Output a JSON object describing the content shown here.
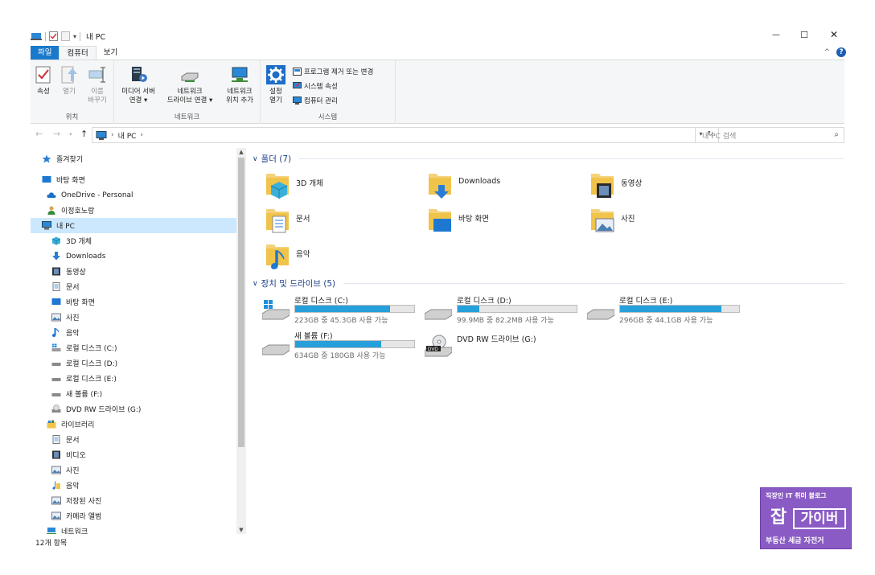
{
  "window": {
    "title": "내 PC",
    "minimize_glyph": "—",
    "maximize_glyph": "☐",
    "close_glyph": "✕"
  },
  "ribbon_tabs": [
    {
      "label": "파일"
    },
    {
      "label": "컴퓨터"
    },
    {
      "label": "보기"
    }
  ],
  "ribbon": {
    "location": {
      "label": "위치",
      "buttons": [
        {
          "label": "속성",
          "icon": "properties-icon"
        },
        {
          "label": "열기",
          "icon": "open-icon"
        },
        {
          "label": "이름\n바꾸기",
          "icon": "rename-icon"
        }
      ]
    },
    "network": {
      "label": "네트워크",
      "buttons": [
        {
          "label": "미디어 서버\n연결 ▾",
          "icon": "media-server-icon"
        },
        {
          "label": "네트워크\n드라이브 연결 ▾",
          "icon": "map-drive-icon"
        },
        {
          "label": "네트워크\n위치 추가",
          "icon": "network-location-icon"
        }
      ]
    },
    "system": {
      "label": "시스템",
      "settings": {
        "label": "설정\n열기",
        "icon": "gear-icon"
      },
      "small_buttons": [
        {
          "label": "프로그램 제거 또는 변경",
          "icon": "uninstall-icon"
        },
        {
          "label": "시스템 속성",
          "icon": "system-properties-icon"
        },
        {
          "label": "컴퓨터 관리",
          "icon": "computer-management-icon"
        }
      ]
    }
  },
  "address": {
    "path": [
      "내 PC"
    ],
    "separator": "›",
    "search_placeholder": "내 PC 검색"
  },
  "sidebar": {
    "items": [
      {
        "label": "즐겨찾기",
        "icon": "star-icon"
      },
      {
        "label": "바탕 화면",
        "icon": "desktop-icon"
      },
      {
        "label": "OneDrive - Personal",
        "icon": "cloud-icon"
      },
      {
        "label": "이정호노랑",
        "icon": "user-icon"
      },
      {
        "label": "내 PC",
        "icon": "pc-icon"
      },
      {
        "label": "3D 개체",
        "icon": "cube-icon"
      },
      {
        "label": "Downloads",
        "icon": "download-icon"
      },
      {
        "label": "동영상",
        "icon": "video-icon"
      },
      {
        "label": "문서",
        "icon": "document-icon"
      },
      {
        "label": "바탕 화면",
        "icon": "desktop-icon"
      },
      {
        "label": "사진",
        "icon": "picture-icon"
      },
      {
        "label": "음악",
        "icon": "music-icon"
      },
      {
        "label": "로컬 디스크 (C:)",
        "icon": "windows-drive-icon"
      },
      {
        "label": "로컬 디스크 (D:)",
        "icon": "drive-icon"
      },
      {
        "label": "로컬 디스크 (E:)",
        "icon": "drive-icon"
      },
      {
        "label": "새 볼륨 (F:)",
        "icon": "drive-icon"
      },
      {
        "label": "DVD RW 드라이브 (G:)",
        "icon": "dvd-icon"
      },
      {
        "label": "라이브러리",
        "icon": "library-icon"
      },
      {
        "label": "문서",
        "icon": "document-icon"
      },
      {
        "label": "비디오",
        "icon": "video-icon"
      },
      {
        "label": "사진",
        "icon": "picture-icon"
      },
      {
        "label": "음악",
        "icon": "music-icon"
      },
      {
        "label": "저장된 사진",
        "icon": "picture-icon"
      },
      {
        "label": "카메라 앨범",
        "icon": "picture-icon"
      },
      {
        "label": "네트워크",
        "icon": "network-icon"
      }
    ]
  },
  "folders_section": {
    "title": "폴더 (7)",
    "items": [
      {
        "label": "3D 개체",
        "icon": "cube-folder-icon"
      },
      {
        "label": "Downloads",
        "icon": "download-folder-icon"
      },
      {
        "label": "동영상",
        "icon": "video-folder-icon"
      },
      {
        "label": "문서",
        "icon": "document-folder-icon"
      },
      {
        "label": "바탕 화면",
        "icon": "desktop-folder-icon"
      },
      {
        "label": "사진",
        "icon": "picture-folder-icon"
      },
      {
        "label": "음악",
        "icon": "music-folder-icon"
      }
    ]
  },
  "drives_section": {
    "title": "장치 및 드라이브 (5)",
    "items": [
      {
        "label": "로컬 디스크 (C:)",
        "info": "223GB 중 45.3GB 사용 가능",
        "used_fraction": 0.8,
        "icon": "windows-drive-icon"
      },
      {
        "label": "로컬 디스크 (D:)",
        "info": "99.9MB 중 82.2MB 사용 가능",
        "used_fraction": 0.18,
        "icon": "drive-icon"
      },
      {
        "label": "로컬 디스크 (E:)",
        "info": "296GB 중 44.1GB 사용 가능",
        "used_fraction": 0.85,
        "icon": "drive-icon"
      },
      {
        "label": "새 볼륨 (F:)",
        "info": "634GB 중 180GB 사용 가능",
        "used_fraction": 0.72,
        "icon": "drive-icon"
      },
      {
        "label": "DVD RW 드라이브 (G:)",
        "info": "",
        "used_fraction": null,
        "icon": "dvd-icon"
      }
    ]
  },
  "status": {
    "item_count": "12개 항목"
  },
  "colors": {
    "accent": "#1979ca",
    "selection": "#cce8ff",
    "bar_fill": "#26a0da",
    "section_title": "#1e3f8a"
  },
  "watermark": {
    "top": "직장인 IT 취미 블로그",
    "logo_char": "잡",
    "name": "가이버",
    "bottom": "부동산 세금 자전거"
  }
}
